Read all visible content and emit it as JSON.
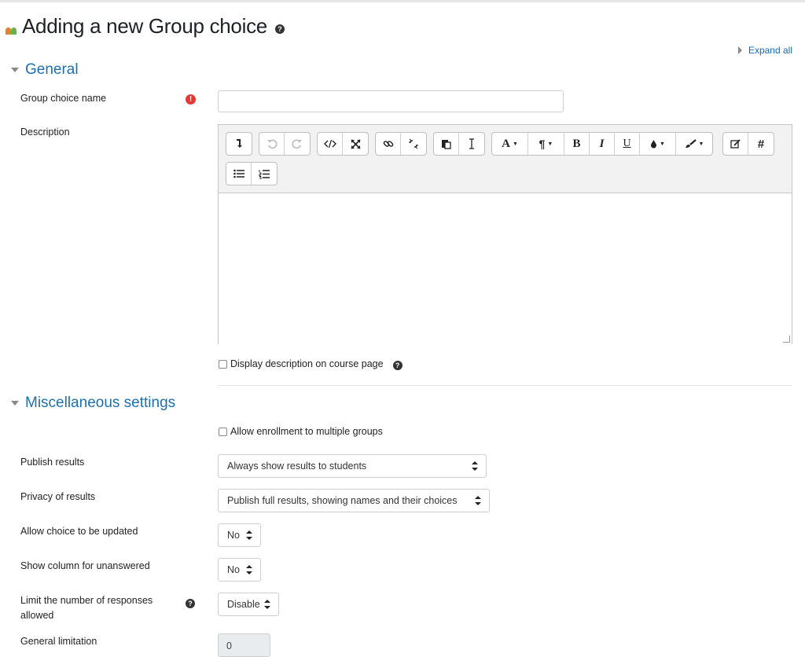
{
  "page": {
    "title": "Adding a new Group choice",
    "expand_all": "Expand all"
  },
  "sections": {
    "general": {
      "title": "General",
      "group_choice_name_label": "Group choice name",
      "group_choice_name_value": "",
      "description_label": "Description",
      "display_description_label": "Display description on course page"
    },
    "misc": {
      "title": "Miscellaneous settings",
      "allow_multiple_label": "Allow enrollment to multiple groups",
      "publish_results_label": "Publish results",
      "publish_results_value": "Always show results to students",
      "privacy_label": "Privacy of results",
      "privacy_value": "Publish full results, showing names and their choices",
      "allow_update_label": "Allow choice to be updated",
      "allow_update_value": "No",
      "show_unanswered_label": "Show column for unanswered",
      "show_unanswered_value": "No",
      "limit_label_line1": "Limit the number of responses",
      "limit_label_line2": "allowed",
      "limit_value": "Disable",
      "general_limitation_label": "General limitation",
      "general_limitation_value": "0"
    }
  },
  "editor": {
    "toolbar_row1": [
      [
        "show-more-icon"
      ],
      [
        "undo-icon",
        "redo-icon"
      ],
      [
        "html-icon",
        "fullscreen-icon"
      ],
      [
        "link-icon",
        "unlink-icon"
      ],
      [
        "paste-icon",
        "clear-formatting-icon"
      ],
      [
        "font-icon",
        "paragraph-icon",
        "bold-icon",
        "italic-icon",
        "underline-icon",
        "font-color-icon",
        "background-color-icon"
      ],
      [
        "equation-icon",
        "hash-icon"
      ]
    ],
    "toolbar_row2": [
      [
        "unordered-list-icon",
        "ordered-list-icon"
      ]
    ]
  },
  "icons": {
    "help": "?",
    "required": "!"
  },
  "colors": {
    "accent": "#1f6fab",
    "link": "#0f6cbf",
    "required": "#e53935"
  }
}
